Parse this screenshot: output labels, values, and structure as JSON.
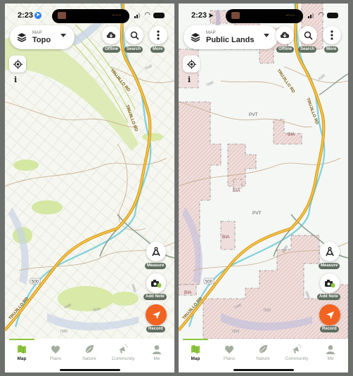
{
  "screens": [
    {
      "id": "left",
      "status": {
        "time": "2:23",
        "location_icon": "location-arrow-filled-icon"
      },
      "map_selector": {
        "caption": "MAP",
        "value": "Topo"
      },
      "top_buttons": [
        {
          "id": "offline",
          "label": "Offline",
          "icon": "cloud-download-icon"
        },
        {
          "id": "search",
          "label": "Search",
          "icon": "search-icon"
        },
        {
          "id": "more",
          "label": "More",
          "icon": "more-vertical-icon"
        }
      ],
      "side_buttons": {
        "locate_icon": "crosshair-icon",
        "info_label": "i"
      },
      "fabs": [
        {
          "id": "measure",
          "label": "Measure",
          "icon": "compass-measure-icon"
        },
        {
          "id": "add-note",
          "label": "Add Note",
          "icon": "camera-leaf-icon"
        },
        {
          "id": "record",
          "label": "Record",
          "icon": "navigation-arrow-icon"
        }
      ],
      "map_labels": {
        "road": "TRUJILLO RD",
        "route_shield": "500",
        "elevations": [
          "7040",
          "7440",
          "7520",
          "7200",
          "6960",
          "7760"
        ]
      }
    },
    {
      "id": "right",
      "status": {
        "time": "2:23",
        "location_icon": "location-arrow-icon"
      },
      "map_selector": {
        "caption": "MAP",
        "value": "Public Lands"
      },
      "top_buttons": [
        {
          "id": "offline",
          "label": "Offline",
          "icon": "cloud-download-icon"
        },
        {
          "id": "search",
          "label": "Search",
          "icon": "search-icon"
        },
        {
          "id": "more",
          "label": "More",
          "icon": "more-vertical-icon"
        }
      ],
      "side_buttons": {
        "locate_icon": "crosshair-icon",
        "info_label": "i"
      },
      "fabs": [
        {
          "id": "measure",
          "label": "Measure",
          "icon": "compass-measure-icon"
        },
        {
          "id": "add-note",
          "label": "Add Note",
          "icon": "camera-leaf-icon"
        },
        {
          "id": "record",
          "label": "Record",
          "icon": "navigation-arrow-icon"
        }
      ],
      "map_labels": {
        "road": "TRUJILLO RD",
        "route_shield": "500",
        "land_labels": [
          "PVT",
          "BIA",
          "PVT",
          "BIA",
          "BIA",
          "BIA"
        ],
        "elevations": [
          "7600",
          "7040",
          "7440",
          "7520",
          "7200",
          "6960",
          "6880"
        ]
      }
    }
  ],
  "tabbar": {
    "items": [
      {
        "id": "map",
        "label": "Map",
        "active": true
      },
      {
        "id": "plans",
        "label": "Plans",
        "active": false
      },
      {
        "id": "nature",
        "label": "Nature",
        "active": false
      },
      {
        "id": "community",
        "label": "Community",
        "active": false
      },
      {
        "id": "me",
        "label": "Me",
        "active": false
      }
    ]
  },
  "colors": {
    "accent_green": "#8cc63f",
    "record_orange": "#f26322",
    "label_pill": "#5f6e5e",
    "road_yellow": "#f2b632",
    "river_blue": "#7fd0dc",
    "public_land_pink": "#d9a9a5"
  }
}
